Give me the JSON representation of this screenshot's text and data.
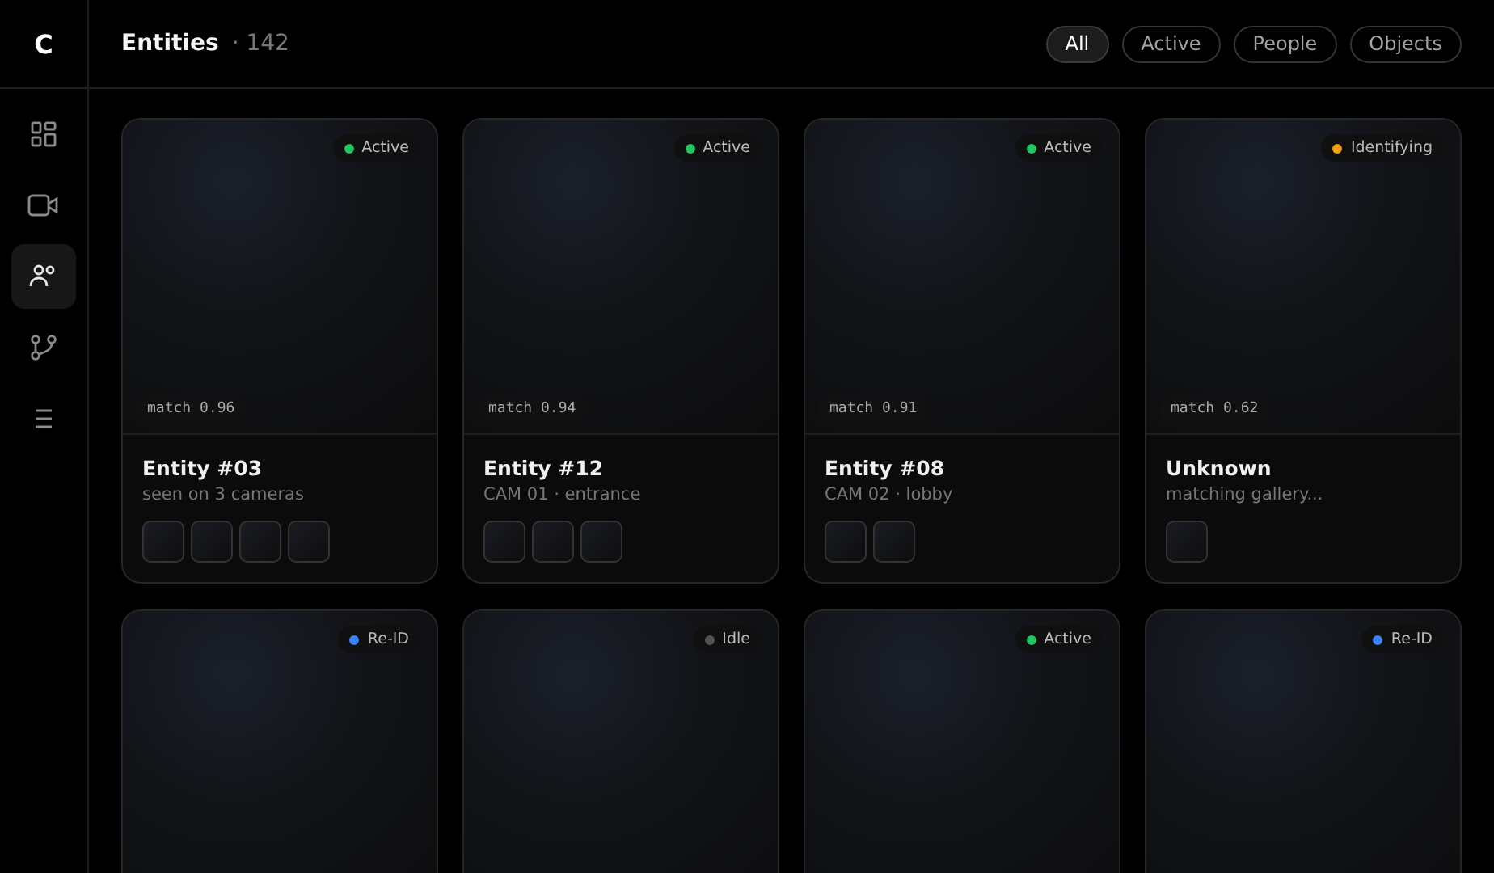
{
  "logo": "C",
  "sidebar": {
    "items": [
      {
        "kind": "grid",
        "selected": false
      },
      {
        "kind": "camera",
        "selected": false
      },
      {
        "kind": "people",
        "selected": true
      },
      {
        "kind": "flow",
        "selected": false
      },
      {
        "kind": "list",
        "selected": false
      }
    ]
  },
  "header": {
    "title": "Entities",
    "count": "· 142"
  },
  "filters": [
    {
      "label": "All",
      "selected": true
    },
    {
      "label": "Active",
      "selected": false
    },
    {
      "label": "People",
      "selected": false
    },
    {
      "label": "Objects",
      "selected": false
    }
  ],
  "entities": [
    {
      "status": "Active",
      "color": "#22c55e",
      "match": "match 0.96",
      "name": "Entity #03",
      "detail": "seen on 3 cameras",
      "thumbnails": [
        {
          "kind": "image"
        },
        {
          "kind": "image"
        },
        {
          "kind": "image"
        },
        {
          "kind": "image"
        }
      ]
    },
    {
      "status": "Active",
      "color": "#22c55e",
      "match": "match 0.94",
      "name": "Entity #12",
      "detail": "CAM 01 · entrance",
      "thumbnails": [
        {
          "kind": "image"
        },
        {
          "kind": "image"
        },
        {
          "kind": "image"
        }
      ]
    },
    {
      "status": "Active",
      "color": "#22c55e",
      "match": "match 0.91",
      "name": "Entity #08",
      "detail": "CAM 02 · lobby",
      "thumbnails": [
        {
          "kind": "image"
        },
        {
          "kind": "image"
        }
      ]
    },
    {
      "status": "Identifying",
      "color": "#f59e0b",
      "match": "match 0.62",
      "name": "Unknown",
      "detail": "matching gallery...",
      "thumbnails": [
        {
          "kind": "image"
        }
      ]
    },
    {
      "status": "Re-ID",
      "color": "#3b82f6"
    },
    {
      "status": "Idle",
      "color": "#525252"
    },
    {
      "status": "Active",
      "color": "#22c55e"
    },
    {
      "status": "Re-ID",
      "color": "#3b82f6"
    }
  ]
}
